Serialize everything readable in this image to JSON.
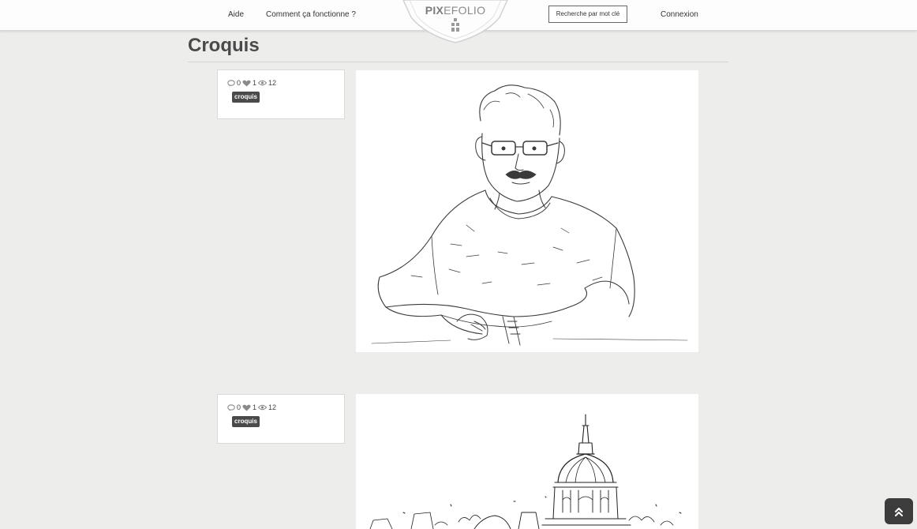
{
  "header": {
    "nav": {
      "help": "Aide",
      "how_it_works": "Comment ça fonctionne ?"
    },
    "logo": {
      "bold": "PIX",
      "light": "EFOLIO"
    },
    "search_button": "Recherche par mot clé",
    "login": "Connexion"
  },
  "page": {
    "title": "Croquis"
  },
  "posts": [
    {
      "comments": "0",
      "likes": "1",
      "views": "12",
      "tag": "croquis",
      "image_icon": "portrait-sketch"
    },
    {
      "comments": "0",
      "likes": "1",
      "views": "12",
      "tag": "croquis",
      "image_icon": "dome-church-sketch"
    }
  ],
  "scroll_top_icon": "double-chevron-up-icon"
}
